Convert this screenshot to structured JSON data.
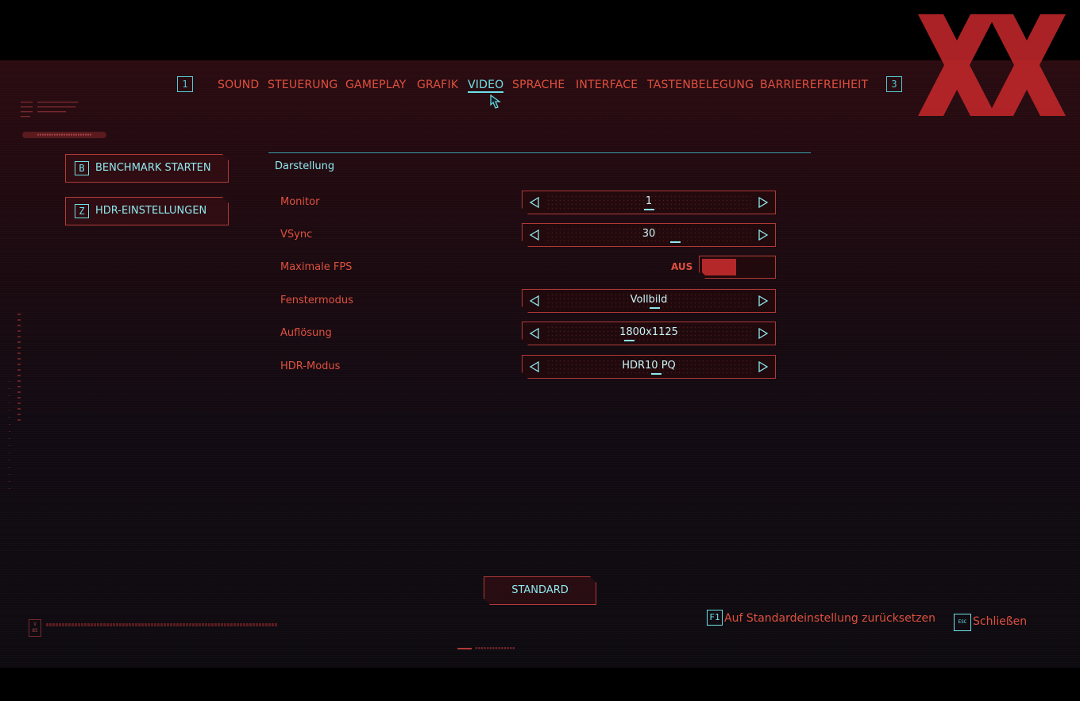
{
  "nav": {
    "left_key": "1",
    "right_key": "3",
    "tabs": [
      {
        "label": "SOUND"
      },
      {
        "label": "STEUERUNG"
      },
      {
        "label": "GAMEPLAY"
      },
      {
        "label": "GRAFIK"
      },
      {
        "label": "VIDEO"
      },
      {
        "label": "SPRACHE"
      },
      {
        "label": "INTERFACE"
      },
      {
        "label": "TASTENBELEGUNG"
      },
      {
        "label": "BARRIEREFREIHEIT"
      }
    ],
    "active_tab": "VIDEO"
  },
  "sidebar": {
    "buttons": [
      {
        "key": "B",
        "label": "BENCHMARK STARTEN"
      },
      {
        "key": "Z",
        "label": "HDR-EINSTELLUNGEN"
      }
    ]
  },
  "settings": {
    "section_title": "Darstellung",
    "rows": [
      {
        "label": "Monitor",
        "value": "1"
      },
      {
        "label": "VSync",
        "value": "30"
      },
      {
        "label": "Maximale FPS",
        "value": "AUS"
      },
      {
        "label": "Fenstermodus",
        "value": "Vollbild"
      },
      {
        "label": "Auflösung",
        "value": "1800x1125"
      },
      {
        "label": "HDR-Modus",
        "value": "HDR10 PQ"
      }
    ]
  },
  "standard_button": {
    "label": "STANDARD"
  },
  "footer": {
    "reset_key": "F1",
    "reset_label": "Auf Standardeinstellung zurücksetzen",
    "close_key": "ESC",
    "close_label": "Schließen",
    "version": "V 85"
  },
  "colors": {
    "accent_red": "#e0503e",
    "accent_cyan": "#6fe0e8",
    "toggle_fill": "#b4282a",
    "watermark": "#c8282c"
  },
  "icons": {
    "prev": "triangle-left-icon",
    "next": "triangle-right-icon",
    "pointer": "hand-cursor-icon",
    "logo": "xx-logo-icon"
  }
}
